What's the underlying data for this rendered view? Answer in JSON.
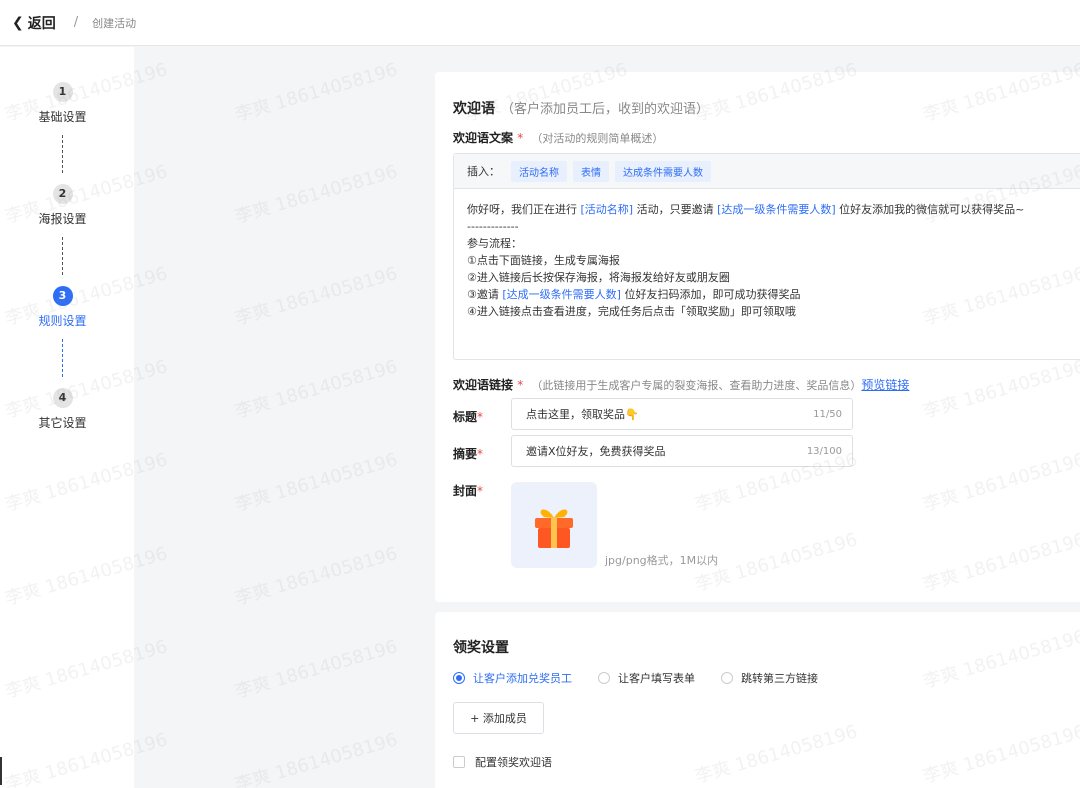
{
  "header": {
    "back_label": "返回",
    "separator": "/",
    "breadcrumb": "创建活动"
  },
  "steps": [
    {
      "number": "1",
      "label": "基础设置"
    },
    {
      "number": "2",
      "label": "海报设置"
    },
    {
      "number": "3",
      "label": "规则设置"
    },
    {
      "number": "4",
      "label": "其它设置"
    }
  ],
  "welcome": {
    "title": "欢迎语",
    "subtitle": "（客户添加员工后，收到的欢迎语）",
    "copy_label": "欢迎语文案",
    "required_mark": "*",
    "copy_hint": "（对活动的规则简单概述）",
    "insert_label": "插入：",
    "insert_tags": [
      "活动名称",
      "表情",
      "达成条件需要人数"
    ],
    "body": {
      "line1_prefix": "你好呀，我们正在进行 ",
      "var_activity": "[活动名称]",
      "line1_mid": " 活动，只要邀请 ",
      "var_count": "[达成一级条件需要人数]",
      "line1_suffix": " 位好友添加我的微信就可以获得奖品~",
      "divider": "-------------",
      "flow_title": "参与流程：",
      "step1": "①点击下面链接，生成专属海报",
      "step2": "②进入链接后长按保存海报，将海报发给好友或朋友圈",
      "step3_prefix": "③邀请 ",
      "step3_var": "[达成一级条件需要人数]",
      "step3_suffix": " 位好友扫码添加，即可成功获得奖品",
      "step4": "④进入链接点击查看进度，完成任务后点击「领取奖励」即可领取哦"
    },
    "link_label": "欢迎语链接",
    "link_hint": "（此链接用于生成客户专属的裂变海报、查看助力进度、奖品信息）",
    "preview_link": "预览链接",
    "title_label": "标题",
    "title_value": "点击这里，领取奖品👇",
    "title_count": "11/50",
    "summary_label": "摘要",
    "summary_value": "邀请X位好友，免费获得奖品",
    "summary_count": "13/100",
    "cover_label": "封面",
    "cover_hint": "jpg/png格式，1M以内"
  },
  "reward": {
    "title": "领奖设置",
    "options": [
      "让客户添加兑奖员工",
      "让客户填写表单",
      "跳转第三方链接"
    ],
    "selected_index": 0,
    "add_member": "+ 添加成员",
    "config_welcome": "配置领奖欢迎语"
  },
  "watermark": "李爽 18614058196",
  "colors": {
    "accent": "#2e6df6",
    "required": "#e5484d"
  }
}
